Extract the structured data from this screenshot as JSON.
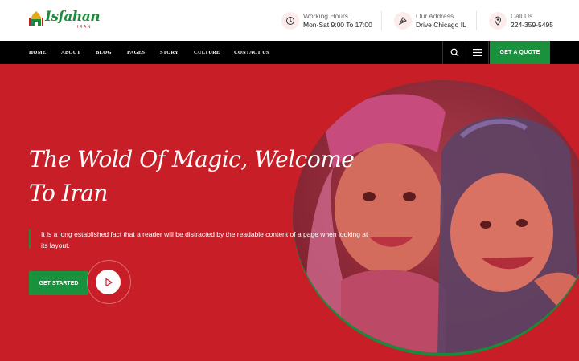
{
  "brand": {
    "name": "Isfahan",
    "tagline": "IRAN",
    "accent_green": "#19913d",
    "accent_red": "#c81e27"
  },
  "topbar": {
    "working_hours": {
      "label": "Working Hours",
      "value": "Mon-Sat 9:00 To 17:00",
      "icon": "clock-icon"
    },
    "address": {
      "label": "Our Address",
      "value": "Drive Chicago IL",
      "icon": "map-pin-icon"
    },
    "call": {
      "label": "Call Us",
      "value": "224-359-5495",
      "icon": "location-icon"
    }
  },
  "nav": {
    "items": [
      {
        "label": "HOME"
      },
      {
        "label": "ABOUT"
      },
      {
        "label": "BLOG"
      },
      {
        "label": "PAGES"
      },
      {
        "label": "STORY"
      },
      {
        "label": "CULTURE"
      },
      {
        "label": "CONTACT US"
      }
    ],
    "quote_label": "GET A QUOTE"
  },
  "hero": {
    "title": "The Wold Of Magic, Welcome To Iran",
    "description": "It is a long established fact that a reader will be distracted by the readable content of a page when looking at its layout.",
    "cta_label": "GET STARTED"
  }
}
